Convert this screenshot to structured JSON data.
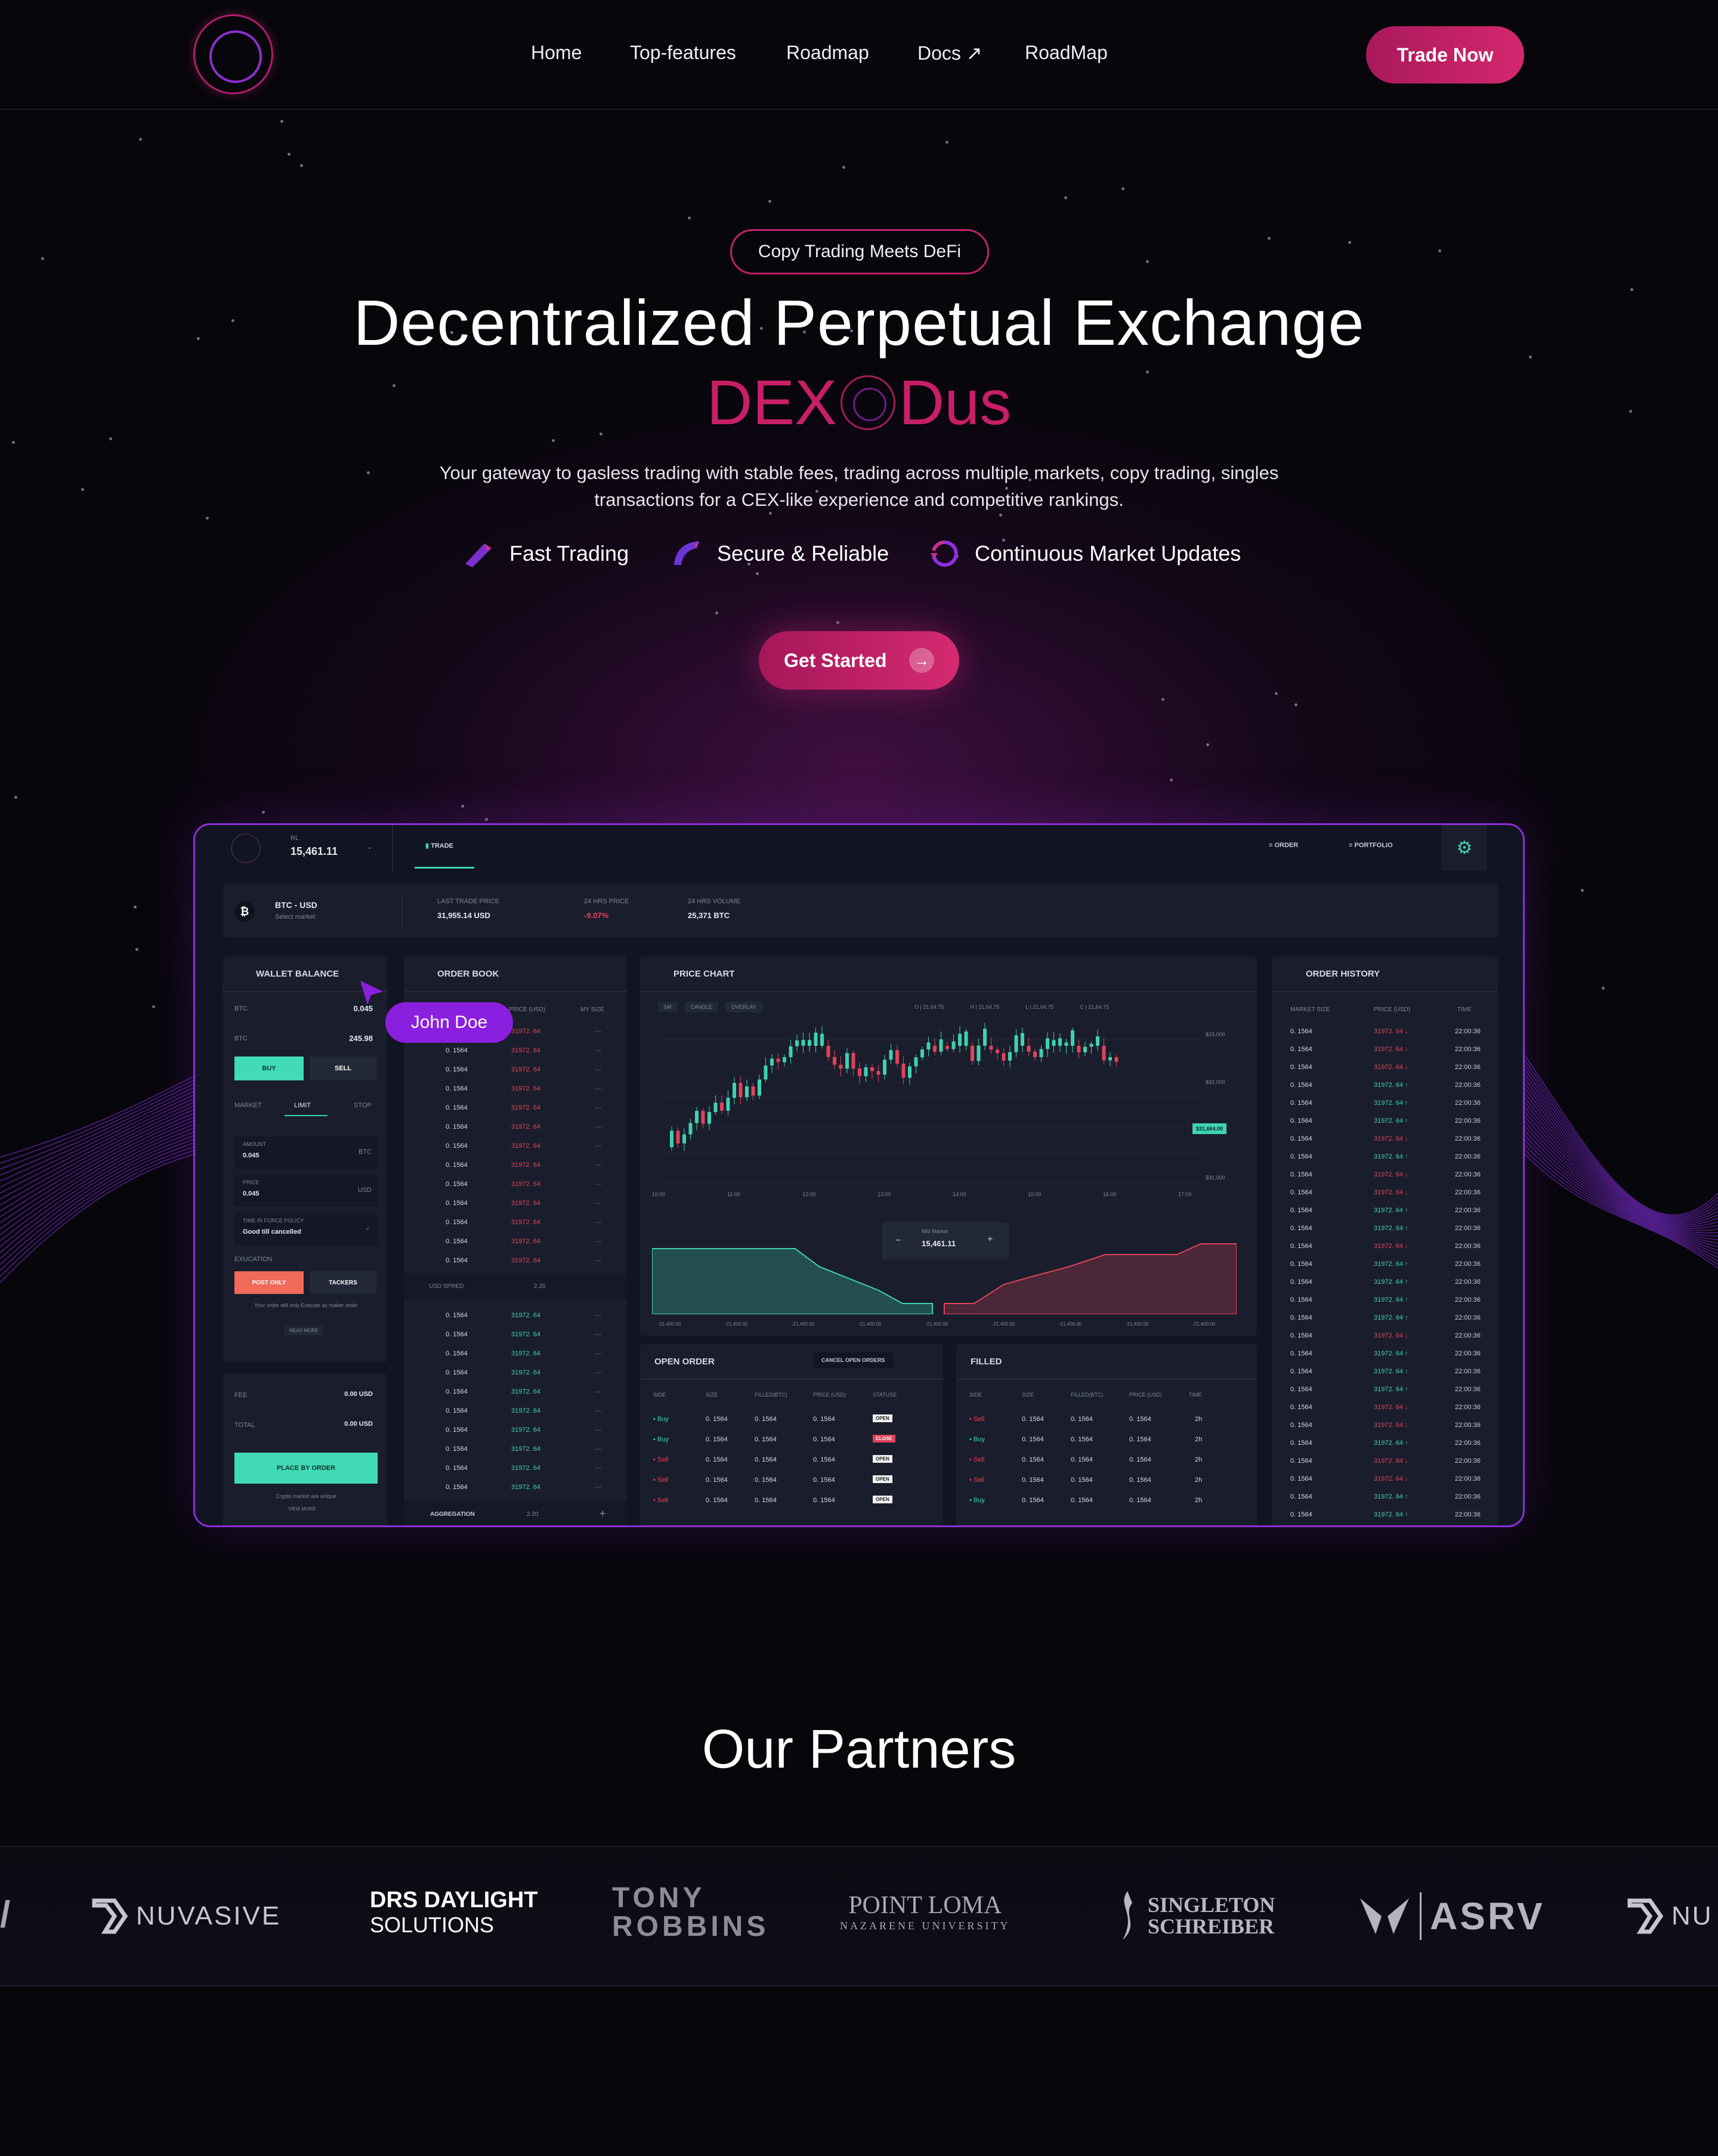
{
  "nav": {
    "links": [
      "Home",
      "Top-features",
      "Roadmap",
      "Docs ↗",
      "RoadMap"
    ],
    "cta": "Trade Now"
  },
  "hero": {
    "badge": "Copy Trading Meets DeFi",
    "headline": "Decentralized Perpetual Exchange",
    "brand_left": "DEX",
    "brand_right": "Dus",
    "subtitle": "Your gateway to gasless trading with stable fees, trading across multiple markets, copy trading, singles transactions for a CEX-like experience and competitive rankings.",
    "features": [
      "Fast Trading",
      "Secure & Reliable",
      "Continuous Market Updates"
    ],
    "cta": "Get Started",
    "cta_icon": "arrow-right-icon"
  },
  "dashboard": {
    "balance_label": "RL",
    "balance_value": "15,461.11",
    "tab_trade": "TRADE",
    "tab_order": "ORDER",
    "tab_portfolio": "PORTFOLIO",
    "pair": "BTC - USD",
    "pair_sub": "Select market",
    "stats": [
      {
        "label": "LAST TRADE PRICE",
        "value": "31,955.14 USD"
      },
      {
        "label": "24 HRS PRICE",
        "value": "-9.07%"
      },
      {
        "label": "24 HRS VOLUME",
        "value": "25,371 BTC"
      }
    ],
    "wallet": {
      "title": "WALLET BALANCE",
      "btc_label": "BTC",
      "btc_value": "0.045",
      "btc2_label": "BTC",
      "btc2_value": "245.98",
      "buy": "BUY",
      "sell": "SELL",
      "order_types": [
        "MARKET",
        "LIMIT",
        "STOP"
      ],
      "amount_label": "AMOUNT",
      "amount_value": "0.045",
      "amount_unit": "BTC",
      "price_label": "PRICE",
      "price_value": "0.045",
      "price_unit": "USD",
      "tif_label": "TIME IN FORCE POLICY",
      "tif_value": "Good till cancelled",
      "execution": "EXUCATION",
      "post_only": "POST ONLY",
      "tackers": "TACKERS",
      "note": "Your order will only Execute as maker order",
      "read_more": "READ MORE",
      "fee_label": "FEE",
      "fee_value": "0.00 USD",
      "total_label": "TOTAL",
      "total_value": "0.00 USD",
      "place_order": "PLACE BY ORDER",
      "footer_note": "Crypto market are unique",
      "view_more": "VIEW MORE"
    },
    "cursor_label": "John Doe",
    "order_book": {
      "title": "ORDER BOOK",
      "columns": [
        "PRICE (USD)",
        "MY SIZE"
      ],
      "size": "0. 1564",
      "price": "31972. 64",
      "spread_label": "USD SPRED",
      "spread_value": "2.20",
      "aggregation_label": "AGGREGATION",
      "aggregation_value": "2.20"
    },
    "price_chart": {
      "title": "PRICE CHART",
      "controls": [
        "5M",
        "CANDLE",
        "OVERLAY"
      ],
      "ohlc": [
        "O | 21,64.75",
        "H | 21,64.75",
        "L | 21,64.75",
        "C | 21,64.75"
      ],
      "y_ticks": [
        "$33,000",
        "$32,000",
        "$31,664.00",
        "$31,000"
      ],
      "x_ticks": [
        "10:00",
        "11:00",
        "12:00",
        "13:00",
        "14:00",
        "15:00",
        "16:00",
        "17:00"
      ],
      "mid_label": "Mid Market",
      "mid_value": "15,461.11",
      "depth_ticks": [
        "-21,400.00",
        "-21,400.00",
        "-21,400.00",
        "-21,400.00",
        "-21,400.00",
        "-21,400.00",
        "-21,400.00",
        "-21,400.00",
        "-21,400.00"
      ]
    },
    "open_order": {
      "title": "OPEN ORDER",
      "cancel": "CANCEL OPEN ORDERS",
      "columns": [
        "SIDE",
        "SIZE",
        "FILLED(BTC)",
        "PRICE (USD)",
        "STATUSE"
      ],
      "rows": [
        {
          "side": "Buy",
          "status": "OPEN"
        },
        {
          "side": "Buy",
          "status": "CLOSE"
        },
        {
          "side": "Sell",
          "status": "OPEN"
        },
        {
          "side": "Sell",
          "status": "OPEN"
        },
        {
          "side": "Sell",
          "status": "OPEN"
        }
      ],
      "cell": "0. 1564"
    },
    "filled": {
      "title": "FILLED",
      "columns": [
        "SIDE",
        "SIZE",
        "FILLED(BTC)",
        "PRICE (USD)",
        "TIME"
      ],
      "sides": [
        "Sell",
        "Buy",
        "Sell",
        "Sell",
        "Buy"
      ],
      "cell": "0. 1564",
      "time": "2h"
    },
    "order_history": {
      "title": "ORDER HISTORY",
      "columns": [
        "MARKET SIZE",
        "PRICE (USD)",
        "TIME"
      ],
      "size": "0. 1564",
      "price": "31972. 64",
      "time": "22:00:36"
    }
  },
  "partners": {
    "title": "Our Partners",
    "logos": [
      "NUVASIVE",
      "DRS DAYLIGHT",
      "SOLUTIONS",
      "TONY",
      "ROBBINS",
      "POINT LOMA",
      "NAZARENE UNIVERSITY",
      "SINGLETON",
      "SCHREIBER",
      "ASRV",
      "NU"
    ]
  },
  "colors": {
    "accent": "#c81f67",
    "purple": "#8b2fd8",
    "green": "#3fd1b2",
    "red": "#e0425b"
  }
}
